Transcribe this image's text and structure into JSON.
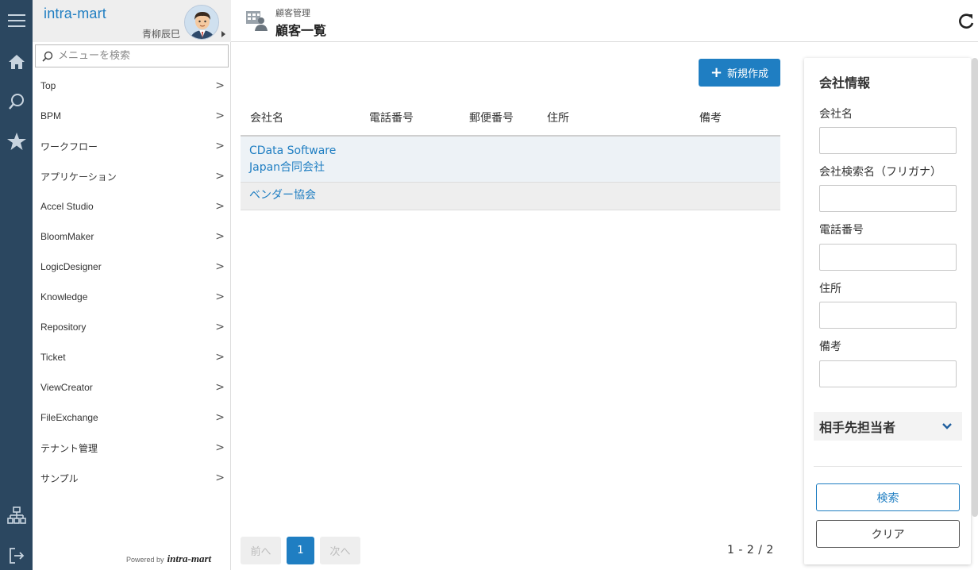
{
  "brand": {
    "logo": "intra-mart",
    "user_name": "青柳辰巳",
    "powered_by": "Powered by",
    "powered_logo": "intra-mart"
  },
  "rail": {
    "icons": [
      "menu-icon",
      "home-icon",
      "search-icon",
      "star-icon",
      "sitemap-icon",
      "logout-icon"
    ]
  },
  "sidebar": {
    "search_placeholder": "メニューを検索",
    "items": [
      {
        "label": "Top"
      },
      {
        "label": "BPM"
      },
      {
        "label": "ワークフロー"
      },
      {
        "label": "アプリケーション"
      },
      {
        "label": "Accel Studio"
      },
      {
        "label": "BloomMaker"
      },
      {
        "label": "LogicDesigner"
      },
      {
        "label": "Knowledge"
      },
      {
        "label": "Repository"
      },
      {
        "label": "Ticket"
      },
      {
        "label": "ViewCreator"
      },
      {
        "label": "FileExchange"
      },
      {
        "label": "テナント管理"
      },
      {
        "label": "サンプル"
      }
    ],
    "chevron": ">"
  },
  "header": {
    "parent": "顧客管理",
    "title": "顧客一覧"
  },
  "main": {
    "new_button": "新規作成",
    "columns": [
      "会社名",
      "電話番号",
      "郵便番号",
      "住所",
      "備考"
    ],
    "rows": [
      {
        "company_line1": "CData Software",
        "company_line2": "Japan合同会社"
      },
      {
        "company_line1": "ベンダー協会"
      }
    ],
    "pager": {
      "prev": "前へ",
      "current": "1",
      "next": "次へ",
      "count": "1 -  2 / 2"
    }
  },
  "panel": {
    "title": "会社情報",
    "fields": [
      {
        "label": "会社名",
        "value": ""
      },
      {
        "label": "会社検索名（フリガナ）",
        "value": ""
      },
      {
        "label": "電話番号",
        "value": ""
      },
      {
        "label": "住所",
        "value": ""
      },
      {
        "label": "備考",
        "value": ""
      }
    ],
    "contact_section": "相手先担当者",
    "search_button": "検索",
    "clear_button": "クリア"
  },
  "colors": {
    "rail": "#2b4760",
    "accent": "#1f7ec2",
    "row_alt": "#edf2f6"
  }
}
